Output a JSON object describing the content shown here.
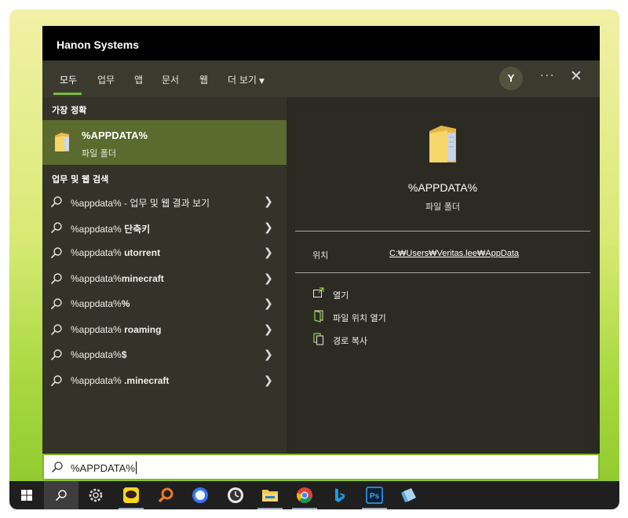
{
  "window": {
    "title": "Hanon Systems"
  },
  "tabs": [
    {
      "label": "모두",
      "active": true
    },
    {
      "label": "업무"
    },
    {
      "label": "앱"
    },
    {
      "label": "문서"
    },
    {
      "label": "웹"
    },
    {
      "label": "더 보기"
    }
  ],
  "header": {
    "avatar_letter": "Y",
    "more_label": "···",
    "close_label": "✕"
  },
  "left": {
    "best_match_heading": "가장 정확",
    "best_match": {
      "title": "%APPDATA%",
      "subtitle": "파일 폴더"
    },
    "web_heading": "업무 및 웹 검색",
    "results": [
      {
        "prefix": "%appdata% - 업무 및 웹 결과 보기",
        "bold": ""
      },
      {
        "prefix": "%appdata% ",
        "bold": "단축키"
      },
      {
        "prefix": "%appdata% ",
        "bold": "utorrent"
      },
      {
        "prefix": "%appdata%",
        "bold": "minecraft"
      },
      {
        "prefix": "%appdata%",
        "bold": "%"
      },
      {
        "prefix": "%appdata% ",
        "bold": "roaming"
      },
      {
        "prefix": "%appdata%",
        "bold": "$"
      },
      {
        "prefix": "%appdata% ",
        "bold": ".minecraft"
      }
    ]
  },
  "detail": {
    "title": "%APPDATA%",
    "subtitle": "파일 폴더",
    "location_label": "위치",
    "location_path": "C:₩Users₩Veritas.lee₩AppData",
    "actions": [
      {
        "label": "열기",
        "icon": "open-icon"
      },
      {
        "label": "파일 위치 열기",
        "icon": "file-location-icon"
      },
      {
        "label": "경로 복사",
        "icon": "copy-path-icon"
      }
    ]
  },
  "search": {
    "value": "%APPDATA%"
  },
  "colors": {
    "accent": "#7fb62e",
    "selected": "#5b6a2e",
    "folder": "#f2c94c"
  },
  "taskbar": [
    "windows-start-icon",
    "search-icon",
    "settings-gear-icon",
    "kakaotalk-icon",
    "search-app-icon",
    "signal-chat-icon",
    "clock-app-icon",
    "file-explorer-icon",
    "chrome-icon",
    "bing-icon",
    "photoshop-icon",
    "notepad-icon"
  ]
}
